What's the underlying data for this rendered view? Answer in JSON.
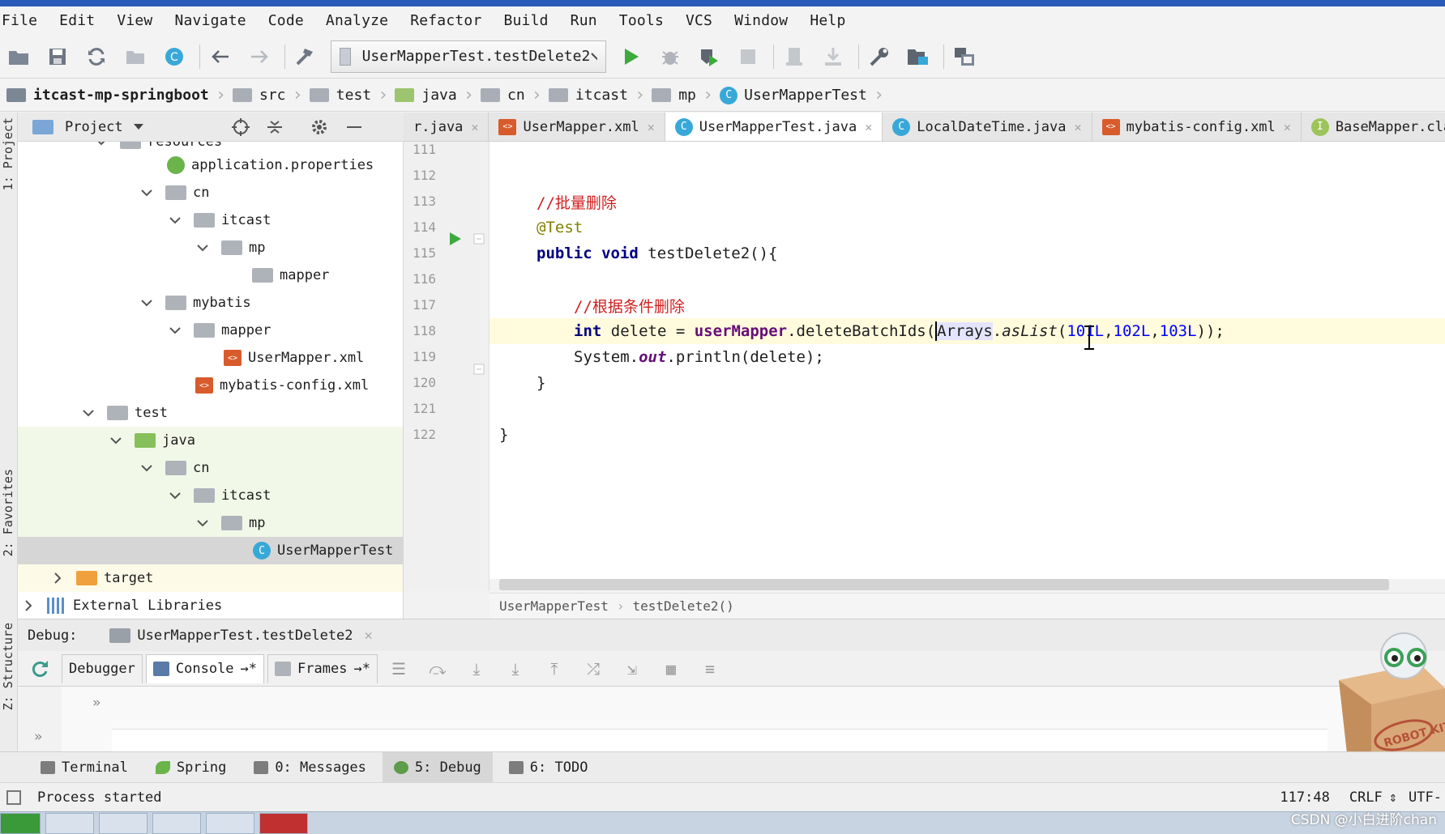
{
  "menu": [
    "File",
    "Edit",
    "View",
    "Navigate",
    "Code",
    "Analyze",
    "Refactor",
    "Build",
    "Run",
    "Tools",
    "VCS",
    "Window",
    "Help"
  ],
  "toolbar": {
    "run_config": "UserMapperTest.testDelete2"
  },
  "navbar": [
    "itcast-mp-springboot",
    "src",
    "test",
    "java",
    "cn",
    "itcast",
    "mp",
    "UserMapperTest"
  ],
  "left_strip": {
    "project": "1: Project",
    "favorites": "2: Favorites",
    "structure": "Z: Structure"
  },
  "project_panel": {
    "title": "Project",
    "tree": [
      {
        "label": "resources"
      },
      {
        "label": "application.properties"
      },
      {
        "label": "cn"
      },
      {
        "label": "itcast"
      },
      {
        "label": "mp"
      },
      {
        "label": "mapper"
      },
      {
        "label": "mybatis"
      },
      {
        "label": "mapper"
      },
      {
        "label": "UserMapper.xml"
      },
      {
        "label": "mybatis-config.xml"
      },
      {
        "label": "test"
      },
      {
        "label": "java"
      },
      {
        "label": "cn"
      },
      {
        "label": "itcast"
      },
      {
        "label": "mp"
      },
      {
        "label": "UserMapperTest"
      },
      {
        "label": "target"
      },
      {
        "label": "External Libraries"
      }
    ]
  },
  "editor_tabs": [
    {
      "label": "r.java"
    },
    {
      "label": "UserMapper.xml"
    },
    {
      "label": "UserMapperTest.java"
    },
    {
      "label": "LocalDateTime.java"
    },
    {
      "label": "mybatis-config.xml"
    },
    {
      "label": "BaseMapper.class"
    }
  ],
  "line_numbers": [
    "111",
    "112",
    "113",
    "114",
    "115",
    "116",
    "117",
    "118",
    "119",
    "120",
    "121",
    "122"
  ],
  "code": {
    "l112": "//批量删除",
    "l113": "@Test",
    "l114_kw1": "public",
    "l114_kw2": "void",
    "l114_rest": " testDelete2(){",
    "l116": "//根据条件删除",
    "l117_kw": "int",
    "l117_a": " delete = ",
    "l117_field": "userMapper",
    "l117_b": ".deleteBatchIds(",
    "l117_arrays": "Arrays",
    "l117_dot": ".",
    "l117_aslist": "asList",
    "l117_open": "(",
    "l117_n1": "101L",
    "l117_comma1": ",",
    "l117_n2": "102L",
    "l117_comma2": ",",
    "l117_n3": "103L",
    "l117_close": "));",
    "l118_a": "System.",
    "l118_out": "out",
    "l118_b": ".println(delete);",
    "l119": "}",
    "l121": "}"
  },
  "editor_breadcrumb": [
    "UserMapperTest",
    "testDelete2()"
  ],
  "debug": {
    "label": "Debug:",
    "session": "UserMapperTest.testDelete2",
    "tabs": [
      "Debugger",
      "Console",
      "Frames"
    ]
  },
  "tool_tabs": [
    {
      "label": "Terminal"
    },
    {
      "label": "Spring"
    },
    {
      "label": "0: Messages"
    },
    {
      "label": "5: Debug"
    },
    {
      "label": "6: TODO"
    }
  ],
  "status": {
    "message": "Process started",
    "position": "117:48",
    "line_sep": "CRLF",
    "encoding": "UTF-"
  },
  "robot_label": "ROBOT KIT",
  "watermark": "CSDN @小白进阶chan"
}
